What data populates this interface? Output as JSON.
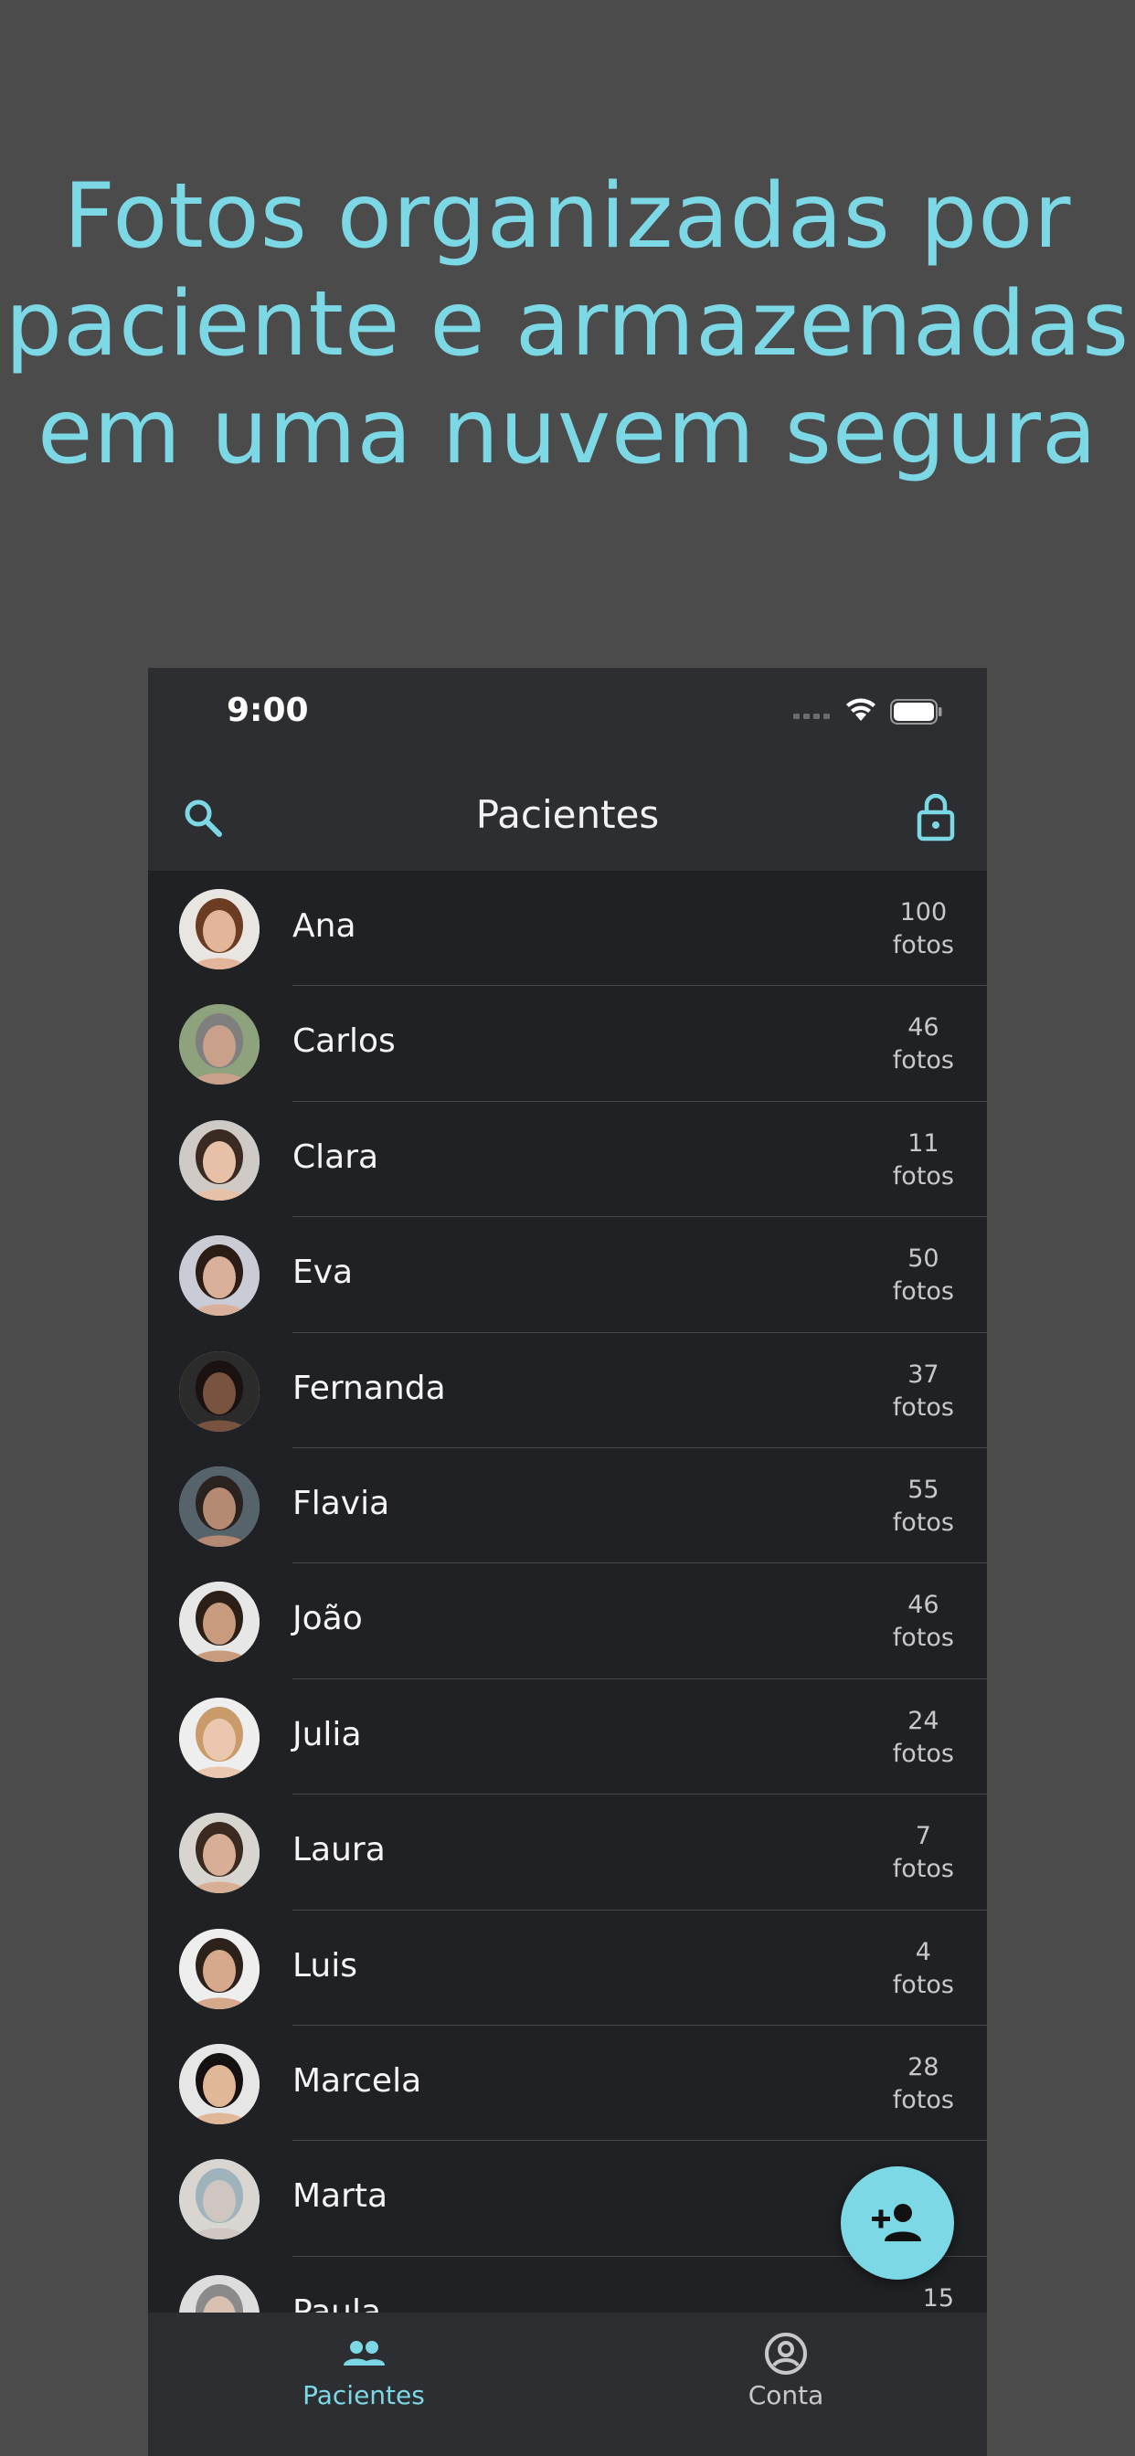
{
  "headline": {
    "line1": "Fotos organizadas por",
    "line2": "paciente e armazenadas",
    "line3": "em uma nuvem segura"
  },
  "status_bar": {
    "time": "9:00"
  },
  "nav": {
    "title": "Pacientes",
    "left_icon": "search-icon",
    "right_icon": "lock-icon"
  },
  "patients": [
    {
      "name": "Ana",
      "count": "100",
      "unit": "fotos"
    },
    {
      "name": "Carlos",
      "count": "46",
      "unit": "fotos"
    },
    {
      "name": "Clara",
      "count": "11",
      "unit": "fotos"
    },
    {
      "name": "Eva",
      "count": "50",
      "unit": "fotos"
    },
    {
      "name": "Fernanda",
      "count": "37",
      "unit": "fotos"
    },
    {
      "name": "Flavia",
      "count": "55",
      "unit": "fotos"
    },
    {
      "name": "João",
      "count": "46",
      "unit": "fotos"
    },
    {
      "name": "Julia",
      "count": "24",
      "unit": "fotos"
    },
    {
      "name": "Laura",
      "count": "7",
      "unit": "fotos"
    },
    {
      "name": "Luis",
      "count": "4",
      "unit": "fotos"
    },
    {
      "name": "Marcela",
      "count": "28",
      "unit": "fotos"
    },
    {
      "name": "Marta",
      "count": "",
      "unit": ""
    },
    {
      "name": "Paula",
      "count": "15",
      "unit": ""
    }
  ],
  "fab": {
    "icon": "add-person-icon"
  },
  "tabs": [
    {
      "label": "Pacientes",
      "icon": "people-icon",
      "active": true
    },
    {
      "label": "Conta",
      "icon": "account-circle-icon",
      "active": false
    }
  ],
  "colors": {
    "accent": "#7dd8e6",
    "background": "#4b4b4c",
    "list_background": "#202124",
    "bar_background": "#2d2e31"
  }
}
